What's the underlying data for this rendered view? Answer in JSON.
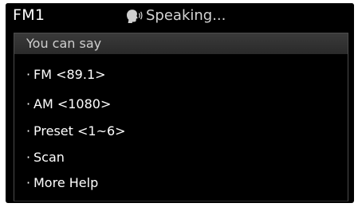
{
  "header": {
    "band": "FM1",
    "status": "Speaking...",
    "status_icon": "speaking-head-icon"
  },
  "panel": {
    "heading": "You can say",
    "bullet": "·",
    "items": [
      {
        "label": "FM <89.1>"
      },
      {
        "label": "AM <1080>"
      },
      {
        "label": "Preset <1~6>"
      },
      {
        "label": "Scan"
      },
      {
        "label": "More Help"
      }
    ]
  },
  "colors": {
    "background": "#000000",
    "heading_bar": "#333333",
    "text": "#ffffff",
    "muted_text": "#cfcfcf"
  }
}
